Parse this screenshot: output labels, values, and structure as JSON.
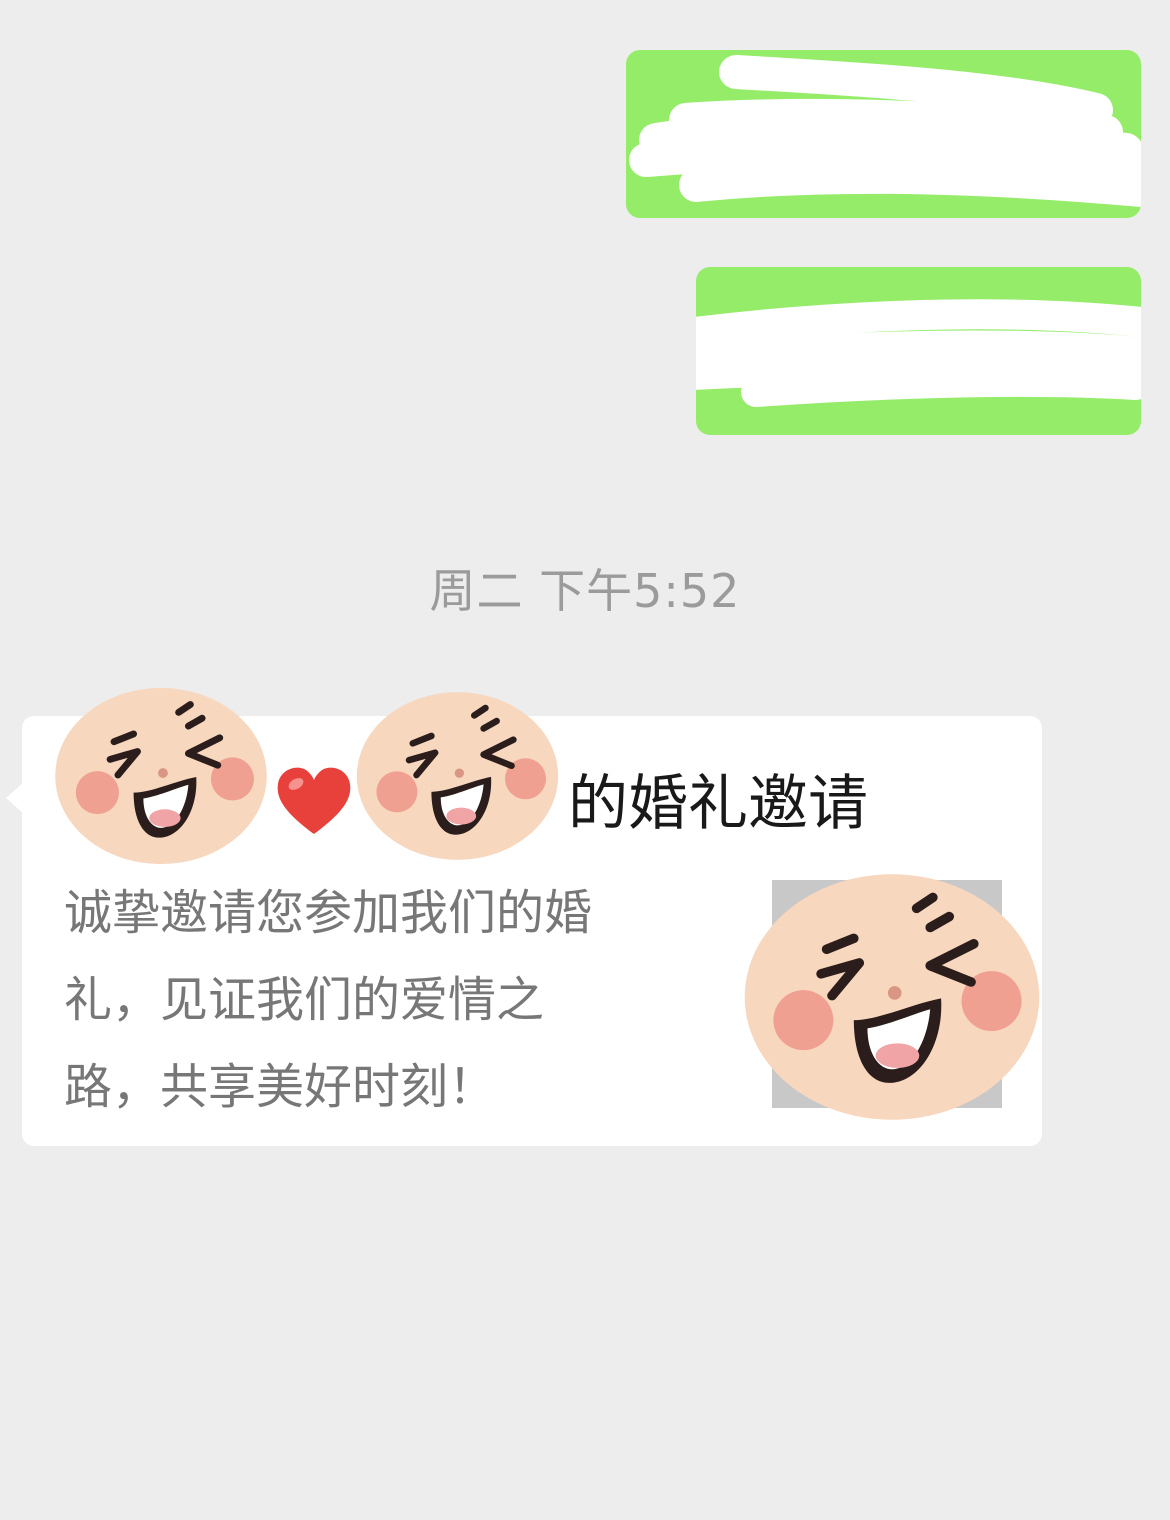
{
  "chat": {
    "timestamp": "周二 下午5:52"
  },
  "link_card": {
    "title_visible": "的婚礼邀请",
    "description_lines": [
      "诚挚邀请您参加我们的婚",
      "礼，见证我们的爱情之",
      "路，共享美好时刻！"
    ]
  },
  "colors": {
    "background": "#ededed",
    "outgoing_bubble": "#95ec69",
    "incoming_bubble": "#ffffff",
    "timestamp_text": "#9b9b9b",
    "card_title_text": "#191919",
    "card_desc_text": "#777777"
  },
  "icons": {
    "sticker": "laughing-face-sticker",
    "heart": "red-heart-emoji"
  }
}
